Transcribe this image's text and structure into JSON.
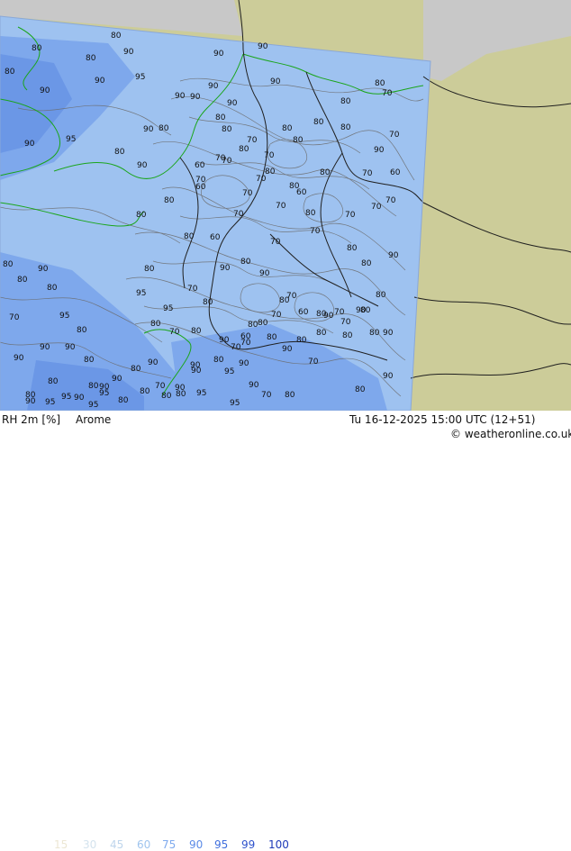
{
  "map": {
    "parameter_label": "RH 2m [%]",
    "model": "Arome",
    "valid_time": "Tu 16-12-2025 15:00 UTC (12+51)",
    "credit": "© weatheronline.co.uk",
    "legend": {
      "values": [
        "15",
        "30",
        "45",
        "60",
        "75",
        "90",
        "95",
        "99",
        "100"
      ],
      "colors": [
        "#ece7d4",
        "#d4e3ee",
        "#bed5ec",
        "#9fc4ee",
        "#7eaaee",
        "#5c8be7",
        "#3f6edd",
        "#2e52cc",
        "#1e3ab8"
      ]
    },
    "colors": {
      "outside_domain": "#cccc99",
      "sea_outside": "#c8c8c8",
      "domain_base": "#9ec2f0",
      "high_rh": "#7ea8ec",
      "very_high_rh": "#6b97e6",
      "country_border": "#1f1f1f",
      "coastline": "#1aa51a",
      "contour": "#6b6b6b"
    },
    "contour_labels": [
      "80",
      "80",
      "80",
      "90",
      "80",
      "95",
      "90",
      "90",
      "90",
      "90",
      "80",
      "90",
      "95",
      "90",
      "80",
      "90",
      "90",
      "90",
      "90",
      "80",
      "70",
      "80",
      "70",
      "80",
      "60",
      "70",
      "70",
      "80",
      "70",
      "70",
      "60",
      "80",
      "70",
      "60",
      "90",
      "80",
      "80",
      "80",
      "70",
      "70",
      "60",
      "80",
      "80",
      "70",
      "90",
      "90",
      "80",
      "70",
      "70",
      "70",
      "80",
      "80",
      "70",
      "90",
      "80",
      "70",
      "80",
      "70",
      "70",
      "80",
      "60",
      "80",
      "80",
      "80",
      "70",
      "80",
      "90",
      "80",
      "90",
      "90",
      "80",
      "90",
      "80",
      "70",
      "80",
      "80",
      "90",
      "90",
      "80",
      "90",
      "80",
      "70",
      "80",
      "70",
      "70",
      "80",
      "90",
      "80",
      "70",
      "80",
      "95",
      "80",
      "90",
      "90",
      "80",
      "80",
      "90",
      "70",
      "80",
      "80",
      "80",
      "90",
      "80",
      "90",
      "90",
      "95",
      "95",
      "90",
      "95",
      "90",
      "80",
      "95",
      "95",
      "90",
      "95",
      "80",
      "90",
      "90",
      "80",
      "80",
      "90",
      "95",
      "95",
      "80",
      "95",
      "70",
      "80",
      "90",
      "70",
      "60",
      "80",
      "80",
      "70",
      "80",
      "70",
      "60",
      "80",
      "70",
      "80",
      "90",
      "80"
    ]
  }
}
